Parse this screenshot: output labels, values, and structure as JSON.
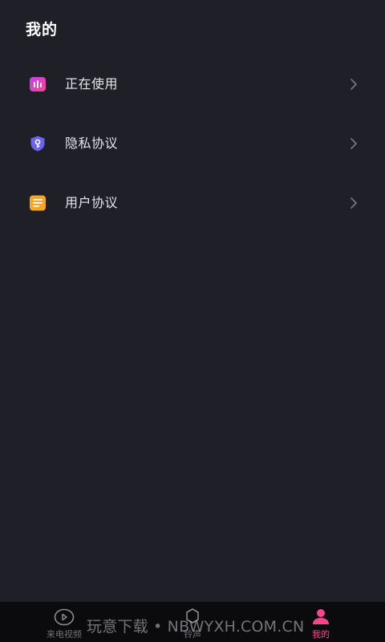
{
  "header": {
    "title": "我的"
  },
  "menu": {
    "items": [
      {
        "label": "正在使用",
        "icon": "sound-wave-icon",
        "icon_color": "#e0408f"
      },
      {
        "label": "隐私协议",
        "icon": "shield-key-icon",
        "icon_color": "#6c63f0"
      },
      {
        "label": "用户协议",
        "icon": "document-list-icon",
        "icon_color": "#f5a623"
      }
    ]
  },
  "tabbar": {
    "tabs": [
      {
        "label": "来电视频",
        "icon": "play-circle-icon",
        "active": false
      },
      {
        "label": "铃声",
        "icon": "bell-icon",
        "active": false
      },
      {
        "label": "我的",
        "icon": "person-icon",
        "active": true
      }
    ]
  },
  "watermark": {
    "text": "玩意下载 • NBWYXH.COM.CN"
  },
  "colors": {
    "background": "#1f1f28",
    "tabbar_background": "#0b0b0d",
    "accent": "#f5468c",
    "inactive": "#6f6f78"
  }
}
